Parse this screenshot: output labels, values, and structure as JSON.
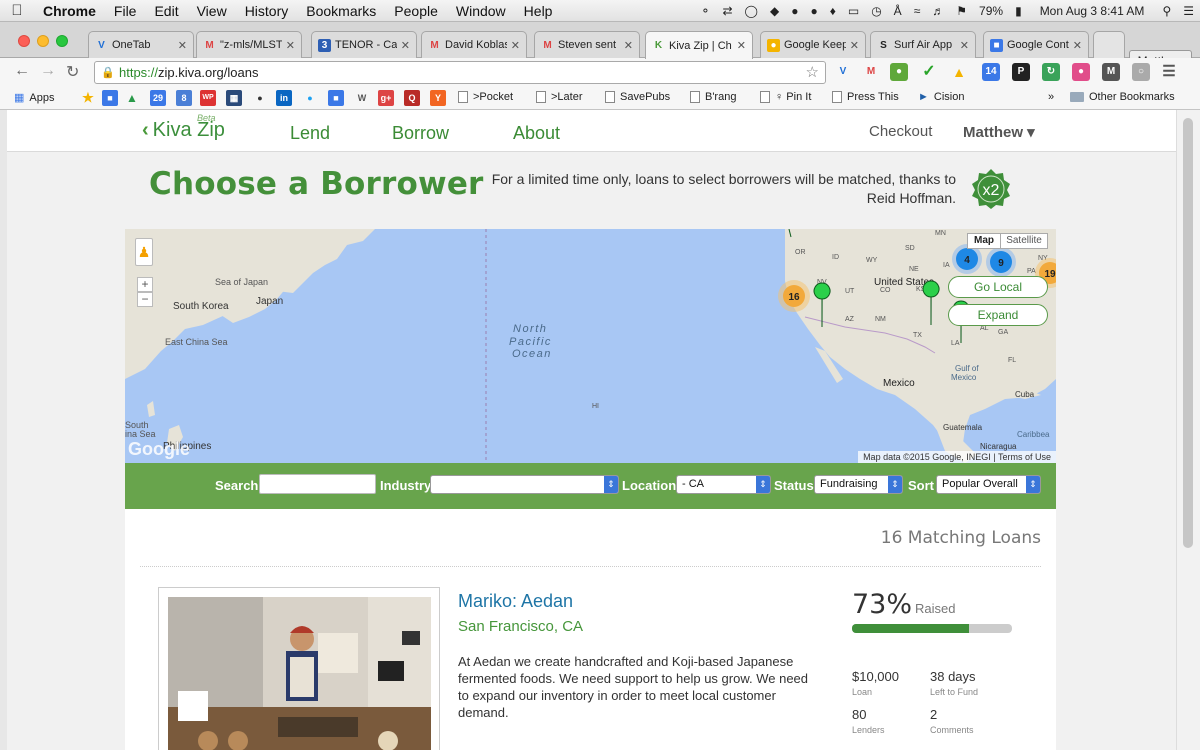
{
  "os_menu": {
    "apple": "",
    "app": "Chrome",
    "items": [
      "File",
      "Edit",
      "View",
      "History",
      "Bookmarks",
      "People",
      "Window",
      "Help"
    ],
    "battery": "79%",
    "clock": "Mon Aug 3  8:41 AM"
  },
  "tabs": [
    {
      "label": "OneTab",
      "icon": "onetab-icon",
      "color": "#1f6fd6"
    },
    {
      "label": "\"z-mls/MLST",
      "icon": "gmail-icon",
      "color": "#d44",
      "prefix": "7"
    },
    {
      "label": "TENOR - Ca",
      "icon": "tenor-icon",
      "color": "#2e5fb4",
      "prefix": "3"
    },
    {
      "label": "David Koblas",
      "icon": "gmail-icon",
      "color": "#d44"
    },
    {
      "label": "Steven sent",
      "icon": "gmail-icon",
      "color": "#d44"
    },
    {
      "label": "Kiva Zip | Ch",
      "icon": "kiva-icon",
      "color": "#4a9a3a"
    },
    {
      "label": "Google Keep",
      "icon": "keep-icon",
      "color": "#f4b400"
    },
    {
      "label": "Surf Air App",
      "icon": "surfair-icon",
      "color": "#222"
    },
    {
      "label": "Google Cont",
      "icon": "contacts-icon",
      "color": "#3b78e7"
    }
  ],
  "profile": "Matthew",
  "address": {
    "scheme": "https://",
    "rest": "zip.kiva.org/loans"
  },
  "bookmarks": {
    "apps": "Apps",
    "items": [
      ">Pocket",
      ">Later",
      "SavePubs",
      "B'rang",
      "♀ Pin It",
      "Press This",
      "Cision"
    ],
    "more": "»",
    "other": "Other Bookmarks"
  },
  "site": {
    "logo": "Kiva Zip",
    "beta": "Beta",
    "nav": [
      "Lend",
      "Borrow",
      "About"
    ],
    "checkout": "Checkout",
    "user": "Matthew ▾"
  },
  "page": {
    "title": "Choose a Borrower",
    "promo": "For a limited time only, loans to select borrowers will be matched, thanks to Reid Hoffman.",
    "badge": "x2"
  },
  "map": {
    "type_map": "Map",
    "type_satellite": "Satellite",
    "go_local": "Go Local",
    "expand": "Expand",
    "attribution": "Map data ©2015 Google, INEGI",
    "terms": "Terms of Use",
    "google": "Google",
    "labels": {
      "sea_of_japan": "Sea of Japan",
      "japan": "Japan",
      "south_korea": "South Korea",
      "east_china_sea": "East China Sea",
      "south_china_sea": "South\nina Sea",
      "philippines": "Philippines",
      "north_pacific_1": "North",
      "north_pacific_2": "Pacific",
      "north_pacific_3": "Ocean",
      "hi": "HI",
      "or": "OR",
      "id": "ID",
      "wy": "WY",
      "sd": "SD",
      "ne": "NE",
      "ia": "IA",
      "nv": "NV",
      "ut": "UT",
      "co": "CO",
      "ks": "KS",
      "az": "AZ",
      "nm": "NM",
      "tx": "TX",
      "la": "LA",
      "fl": "FL",
      "al": "AL",
      "ga": "GA",
      "mn": "MN",
      "ny": "NY",
      "pa": "PA",
      "us": "United States",
      "mexico": "Mexico",
      "gulf": "Gulf of\nMexico",
      "cuba": "Cuba",
      "guatemala": "Guatemala",
      "nicaragua": "Nicaragua",
      "caribbean": "Caribbea"
    },
    "clusters": {
      "west": "16",
      "c4": "4",
      "c9": "9",
      "c19": "19"
    }
  },
  "filters": {
    "search_label": "Search",
    "search_value": "",
    "industry_label": "Industry",
    "industry_value": "",
    "location_label": "Location",
    "location_value": "- CA",
    "status_label": "Status",
    "status_value": "Fundraising",
    "sort_label": "Sort",
    "sort_value": "Popular Overall"
  },
  "results": {
    "count": "16 Matching Loans",
    "loans": [
      {
        "name": "Mariko: Aedan",
        "location": "San Francisco, CA",
        "description": "At Aedan we create handcrafted and Koji-based Japanese fermented foods. We need support to help us grow. We need to expand our inventory in order to meet local customer demand.",
        "percent": "73%",
        "percent_value": 0.73,
        "raised_label": "Raised",
        "loan": "$10,000",
        "loan_label": "Loan",
        "days": "38 days",
        "days_label": "Left to Fund",
        "lenders": "80",
        "lenders_label": "Lenders",
        "comments": "2",
        "comments_label": "Comments"
      }
    ]
  }
}
